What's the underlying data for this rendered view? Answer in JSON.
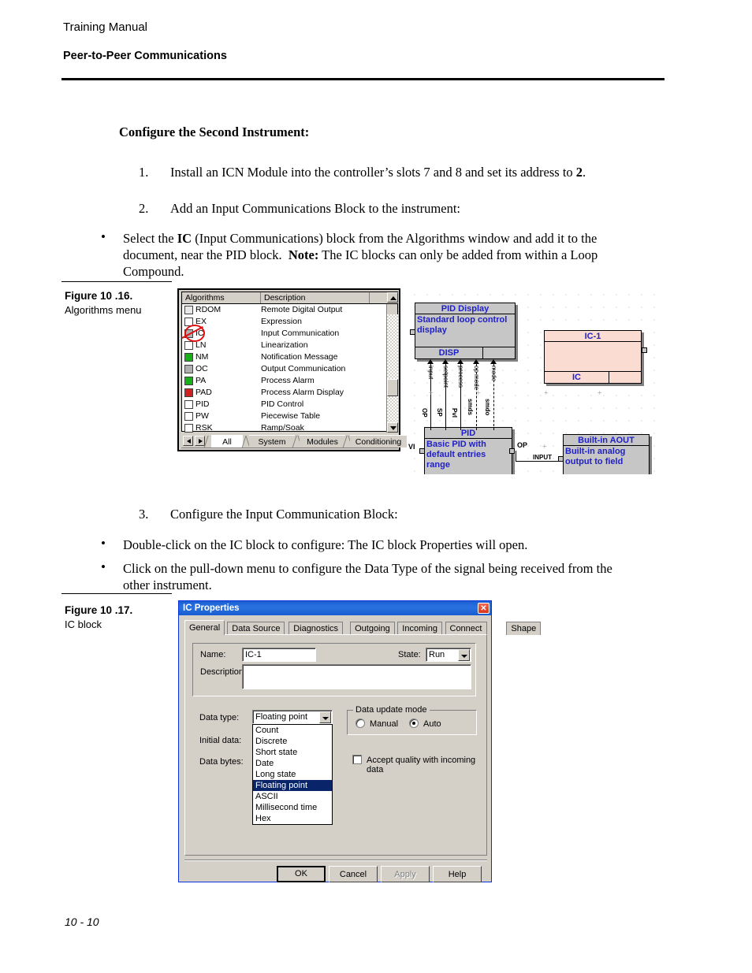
{
  "header": {
    "manual": "Training Manual",
    "chapter": "Peer-to-Peer Communications"
  },
  "footer": {
    "page": "10 - 10"
  },
  "content": {
    "section_title": "Configure the Second Instrument:",
    "steps": [
      {
        "number": "1.",
        "text_html": "Install an ICN Module into the controller’s slots 7 and 8 and set its address to <b>2</b>."
      },
      {
        "number": "2.",
        "text_html": "Add an Input Communications Block to the instrument:"
      },
      {
        "number": "3.",
        "text_html": "Configure the Input Communication Block:"
      }
    ],
    "bullets": [
      {
        "marker": "•",
        "lines_html": [
          "Select the <b>IC</b> (Input Communications) block from the Algorithms window and add it to the",
          "document, near the PID block.&nbsp; <b>Note:</b> The IC blocks can only be added from within a Loop",
          "Compound."
        ]
      },
      {
        "marker": "•",
        "lines_html": [
          "Double-click on the IC block to configure: The IC block Properties will open."
        ]
      },
      {
        "marker": "•",
        "lines_html": [
          "Click on the pull-down menu to configure the Data Type of the signal being received from the",
          "other instrument."
        ]
      }
    ]
  },
  "figures": [
    {
      "id": "fig-10-16",
      "title": "Figure 10 .16.",
      "subtitle": "Algorithms menu"
    },
    {
      "id": "fig-10-17",
      "title": "Figure 10 .17.",
      "subtitle": "IC block"
    }
  ],
  "algorithms_window": {
    "columns": [
      "Algorithms",
      "Description",
      ""
    ],
    "rows": [
      {
        "name": "RDOM",
        "description": "Remote Digital Output",
        "icon": "remote-digital-output-icon",
        "icon_color": "#e8e8e8"
      },
      {
        "name": "EX",
        "description": "Expression",
        "icon": "expression-icon",
        "icon_color": "#ffffff"
      },
      {
        "name": "IC",
        "description": "Input Communication",
        "icon": "input-communication-icon",
        "icon_color": "#b0b0b0"
      },
      {
        "name": "LN",
        "description": "Linearization",
        "icon": "linearization-icon",
        "icon_color": "#ffffff"
      },
      {
        "name": "NM",
        "description": "Notification Message",
        "icon": "notification-message-icon",
        "icon_color": "#18b018"
      },
      {
        "name": "OC",
        "description": "Output Communication",
        "icon": "output-communication-icon",
        "icon_color": "#b0b0b0"
      },
      {
        "name": "PA",
        "description": "Process Alarm",
        "icon": "process-alarm-icon",
        "icon_color": "#18b018"
      },
      {
        "name": "PAD",
        "description": "Process Alarm Display",
        "icon": "process-alarm-display-icon",
        "icon_color": "#d02020"
      },
      {
        "name": "PID",
        "description": "PID Control",
        "icon": "pid-control-icon",
        "icon_color": "#ffffff"
      },
      {
        "name": "PW",
        "description": "Piecewise Table",
        "icon": "piecewise-table-icon",
        "icon_color": "#ffffff"
      },
      {
        "name": "RSK",
        "description": "Ramp/Soak",
        "icon": "ramp-soak-icon",
        "icon_color": "#ffffff"
      }
    ],
    "tabs": [
      {
        "label": "All",
        "selected": true
      },
      {
        "label": "System",
        "selected": false
      },
      {
        "label": "Modules",
        "selected": false
      },
      {
        "label": "Conditioning",
        "selected": false
      }
    ],
    "annotation": {
      "type": "red-circle-strike",
      "target": "IC",
      "color": "#e01010"
    }
  },
  "diagram": {
    "blocks": [
      {
        "id": "pid-display",
        "title": "PID Display",
        "body": "Standard loop control display",
        "footer": "DISP",
        "color": "#c6c6c6"
      },
      {
        "id": "ic-1",
        "title": "IC-1",
        "body": "",
        "footer": "IC",
        "color": "#fadcd2"
      },
      {
        "id": "pid",
        "title": "PID",
        "body": "Basic PID with default entries range",
        "footer": "",
        "color": "#c6c6c6"
      },
      {
        "id": "built-in-aout",
        "title": "Built-in AOUT",
        "body": "Built-in analog output to field",
        "footer": "",
        "color": "#c6c6c6"
      }
    ],
    "signal_labels_top": [
      "input",
      "setpoint",
      "process",
      "op mode",
      "mode"
    ],
    "signal_labels_bottom": [
      "OP",
      "SP",
      "PvI",
      "smds",
      "smdo"
    ],
    "port_labels": [
      "VI",
      "OP",
      "INPUT"
    ]
  },
  "dialog": {
    "title": "IC Properties",
    "close_label": "✕",
    "tabs": [
      {
        "label": "General",
        "selected": true
      },
      {
        "label": "Data Source",
        "selected": false
      },
      {
        "label": "Diagnostics",
        "selected": false
      },
      {
        "label": "Outgoing",
        "selected": false
      },
      {
        "label": "Incoming",
        "selected": false
      },
      {
        "label": "Connect Map",
        "selected": false
      },
      {
        "label": "Shape",
        "selected": false
      }
    ],
    "fields": {
      "name_label": "Name:",
      "name_value": "IC-1",
      "state_label": "State:",
      "state_value": "Run",
      "description_label": "Description:",
      "description_value": "",
      "data_type_label": "Data type:",
      "data_type_value": "Floating point",
      "initial_data_label": "Initial data:",
      "initial_data_value": "",
      "data_bytes_label": "Data bytes:",
      "data_bytes_value": ""
    },
    "data_type_options": [
      "Count",
      "Discrete",
      "Short state",
      "Date",
      "Long state",
      "Floating point",
      "ASCII",
      "Millisecond time",
      "Hex"
    ],
    "data_type_selected": "Floating point",
    "update_mode": {
      "group_label": "Data update mode",
      "options": [
        {
          "label": "Manual",
          "selected": false
        },
        {
          "label": "Auto",
          "selected": true
        }
      ]
    },
    "checkbox": {
      "label": "Accept quality with incoming data",
      "checked": false
    },
    "buttons": [
      {
        "label": "OK",
        "default": true,
        "disabled": false
      },
      {
        "label": "Cancel",
        "default": false,
        "disabled": false
      },
      {
        "label": "Apply",
        "default": false,
        "disabled": true
      },
      {
        "label": "Help",
        "default": false,
        "disabled": false
      }
    ]
  }
}
